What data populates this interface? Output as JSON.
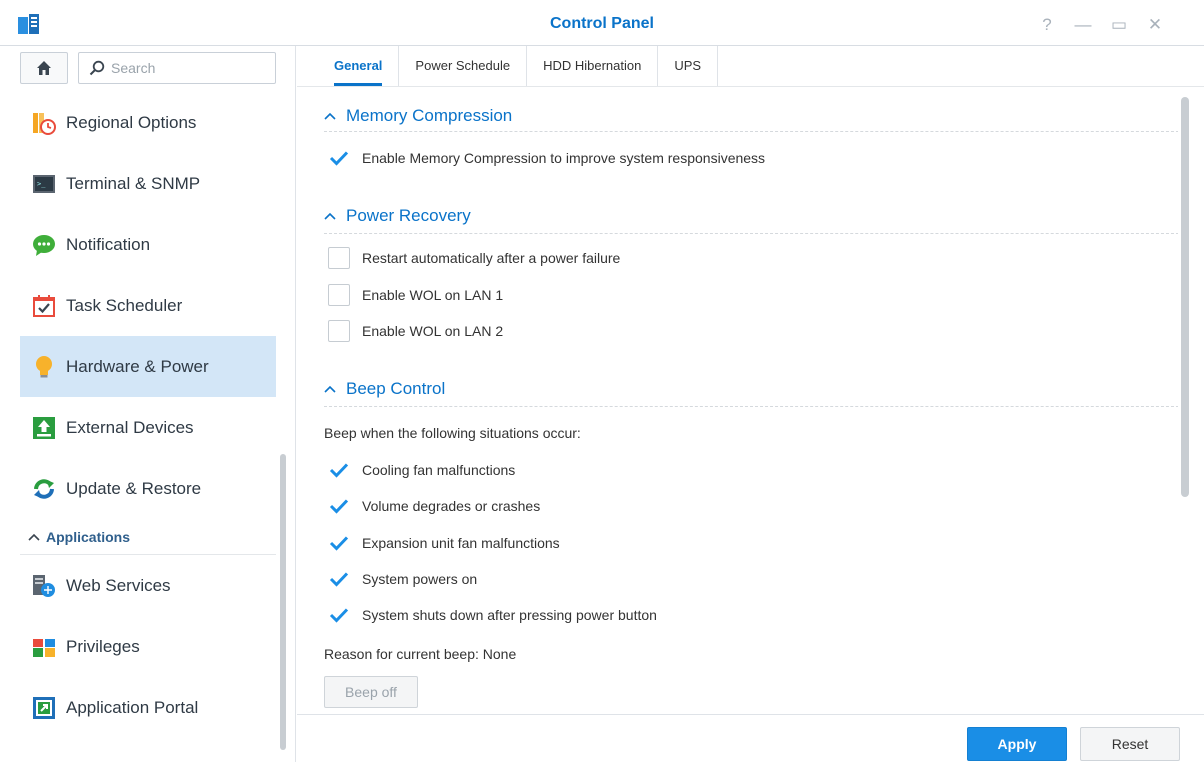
{
  "window": {
    "title": "Control Panel",
    "controls": {
      "help": "?",
      "minimize": "—",
      "maximize": "▭",
      "close": "✕"
    }
  },
  "sidebar": {
    "search_placeholder": "Search",
    "items": [
      {
        "label": "Regional Options",
        "icon": "regional-options-icon"
      },
      {
        "label": "Terminal & SNMP",
        "icon": "terminal-icon"
      },
      {
        "label": "Notification",
        "icon": "notification-icon"
      },
      {
        "label": "Task Scheduler",
        "icon": "task-scheduler-icon"
      },
      {
        "label": "Hardware & Power",
        "icon": "hardware-power-icon",
        "active": true
      },
      {
        "label": "External Devices",
        "icon": "external-devices-icon"
      },
      {
        "label": "Update & Restore",
        "icon": "update-restore-icon"
      }
    ],
    "section": "Applications",
    "app_items": [
      {
        "label": "Web Services",
        "icon": "web-services-icon"
      },
      {
        "label": "Privileges",
        "icon": "privileges-icon"
      },
      {
        "label": "Application Portal",
        "icon": "application-portal-icon"
      }
    ]
  },
  "tabs": [
    {
      "label": "General",
      "active": true
    },
    {
      "label": "Power Schedule"
    },
    {
      "label": "HDD Hibernation"
    },
    {
      "label": "UPS"
    }
  ],
  "memory": {
    "title": "Memory Compression",
    "option": {
      "label": "Enable Memory Compression to improve system responsiveness",
      "checked": true
    }
  },
  "power_recovery": {
    "title": "Power Recovery",
    "options": [
      {
        "label": "Restart automatically after a power failure",
        "checked": false
      },
      {
        "label": "Enable WOL on LAN 1",
        "checked": false
      },
      {
        "label": "Enable WOL on LAN 2",
        "checked": false
      }
    ]
  },
  "beep": {
    "title": "Beep Control",
    "intro": "Beep when the following situations occur:",
    "options": [
      {
        "label": "Cooling fan malfunctions",
        "checked": true
      },
      {
        "label": "Volume degrades or crashes",
        "checked": true
      },
      {
        "label": "Expansion unit fan malfunctions",
        "checked": true
      },
      {
        "label": "System powers on",
        "checked": true
      },
      {
        "label": "System shuts down after pressing power button",
        "checked": true
      }
    ],
    "reason": "Reason for current beep: None",
    "beep_off": "Beep off"
  },
  "footer": {
    "apply": "Apply",
    "reset": "Reset"
  },
  "colors": {
    "accent": "#0a73c9",
    "active_bg": "#d3e6f7",
    "apply_bg": "#1a8ee6"
  }
}
